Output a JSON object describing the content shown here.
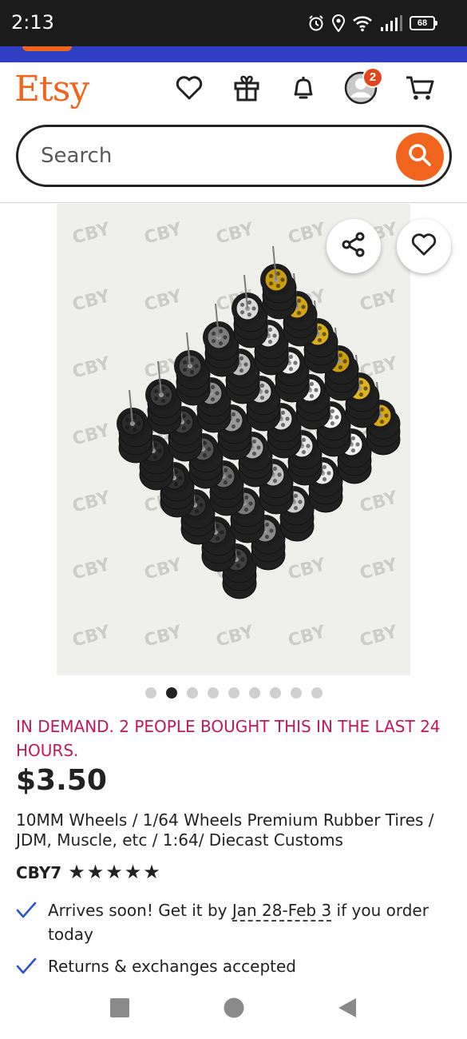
{
  "status_bar": {
    "time": "2:13",
    "battery": "68"
  },
  "header": {
    "logo": "Etsy",
    "cart_badge_count": "2",
    "icons": [
      "heart-icon",
      "gift-icon",
      "bell-icon",
      "account-icon",
      "cart-icon"
    ]
  },
  "search": {
    "placeholder": "Search"
  },
  "product_image": {
    "watermark": "CBY",
    "slide_count": 9,
    "active_slide": 2
  },
  "listing": {
    "demand_notice": "IN DEMAND. 2 PEOPLE BOUGHT THIS IN THE LAST 24 HOURS.",
    "price": "$3.50",
    "title": "10MM Wheels / 1/64 Wheels Premium Rubber Tires / JDM, Muscle, etc / 1:64/ Diecast Customs",
    "shop_name": "CBY7",
    "rating_stars": 5
  },
  "perks": {
    "delivery_prefix": "Arrives soon! Get it by ",
    "delivery_dates": "Jan 28-Feb 3",
    "delivery_suffix": " if you order today",
    "returns": "Returns & exchanges accepted"
  },
  "colors": {
    "brand_orange": "#f1641e",
    "promo_blue": "#2e3fc3",
    "demand_red": "#c2185b",
    "check_blue": "#2b55c7"
  }
}
